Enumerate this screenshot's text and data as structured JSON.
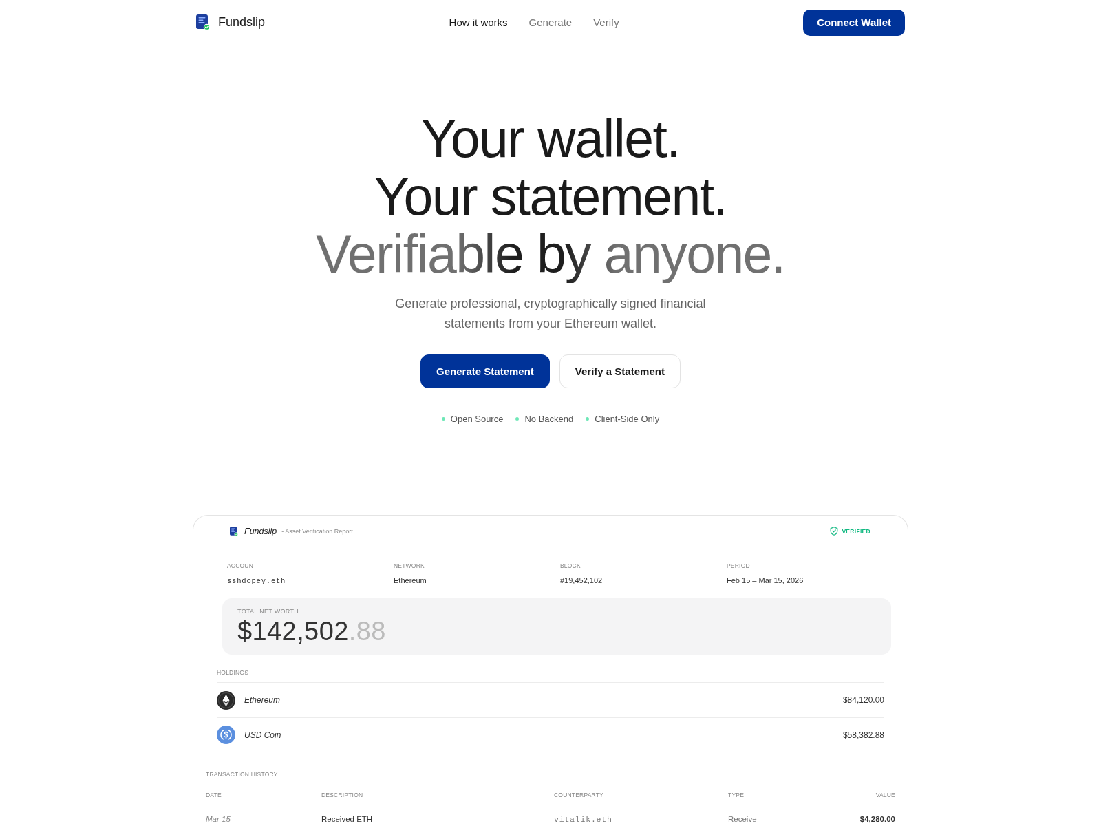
{
  "nav": {
    "brand": "Fundslip",
    "links": [
      {
        "label": "How it works",
        "selected": true
      },
      {
        "label": "Generate",
        "selected": false
      },
      {
        "label": "Verify",
        "selected": false
      }
    ],
    "button": "Connect Wallet"
  },
  "hero": {
    "headline": [
      {
        "text": "Your wallet.",
        "kind": "solid"
      },
      {
        "text": "Your statement.",
        "kind": "solid"
      },
      {
        "text": "Verifiable by anyone.",
        "kind": "gradient"
      }
    ],
    "subtitle": "Generate professional, cryptographically signed financial statements from your Ethereum wallet.",
    "actions": [
      {
        "label": "Generate Statement",
        "kind": "primary"
      },
      {
        "label": "Verify a Statement",
        "kind": "secondary"
      }
    ],
    "features": [
      "Open Source",
      "No Backend",
      "Client-Side Only"
    ]
  },
  "statement_preview": {
    "brand": "Fundslip",
    "subtitle": "- Asset Verification Report",
    "status": "VERIFIED",
    "meta": [
      {
        "label": "ACCOUNT",
        "value": "sshdopey.eth",
        "kind": "mono"
      },
      {
        "label": "NETWORK",
        "value": "Ethereum",
        "kind": "text"
      },
      {
        "label": "BLOCK",
        "value": "#19,452,102",
        "kind": "text"
      },
      {
        "label": "PERIOD",
        "value": "Feb 15 – Mar 15, 2026",
        "kind": "text"
      }
    ],
    "net_worth": {
      "label": "TOTAL NET WORTH",
      "whole": "$142,502",
      "cents": ".88"
    },
    "holdings": {
      "title": "HOLDINGS",
      "rows": [
        {
          "name": "Ethereum",
          "kind": "eth",
          "value": "$84,120.00"
        },
        {
          "name": "USD Coin",
          "kind": "usdc",
          "value": "$58,382.88"
        }
      ]
    },
    "transactions": {
      "title": "TRANSACTION HISTORY",
      "columns": [
        "DATE",
        "DESCRIPTION",
        "COUNTERPARTY",
        "TYPE",
        "VALUE"
      ],
      "rows": [
        [
          "Mar 15",
          "Received ETH",
          "vitalik.eth",
          "Receive",
          "$4,280.00"
        ]
      ]
    }
  }
}
